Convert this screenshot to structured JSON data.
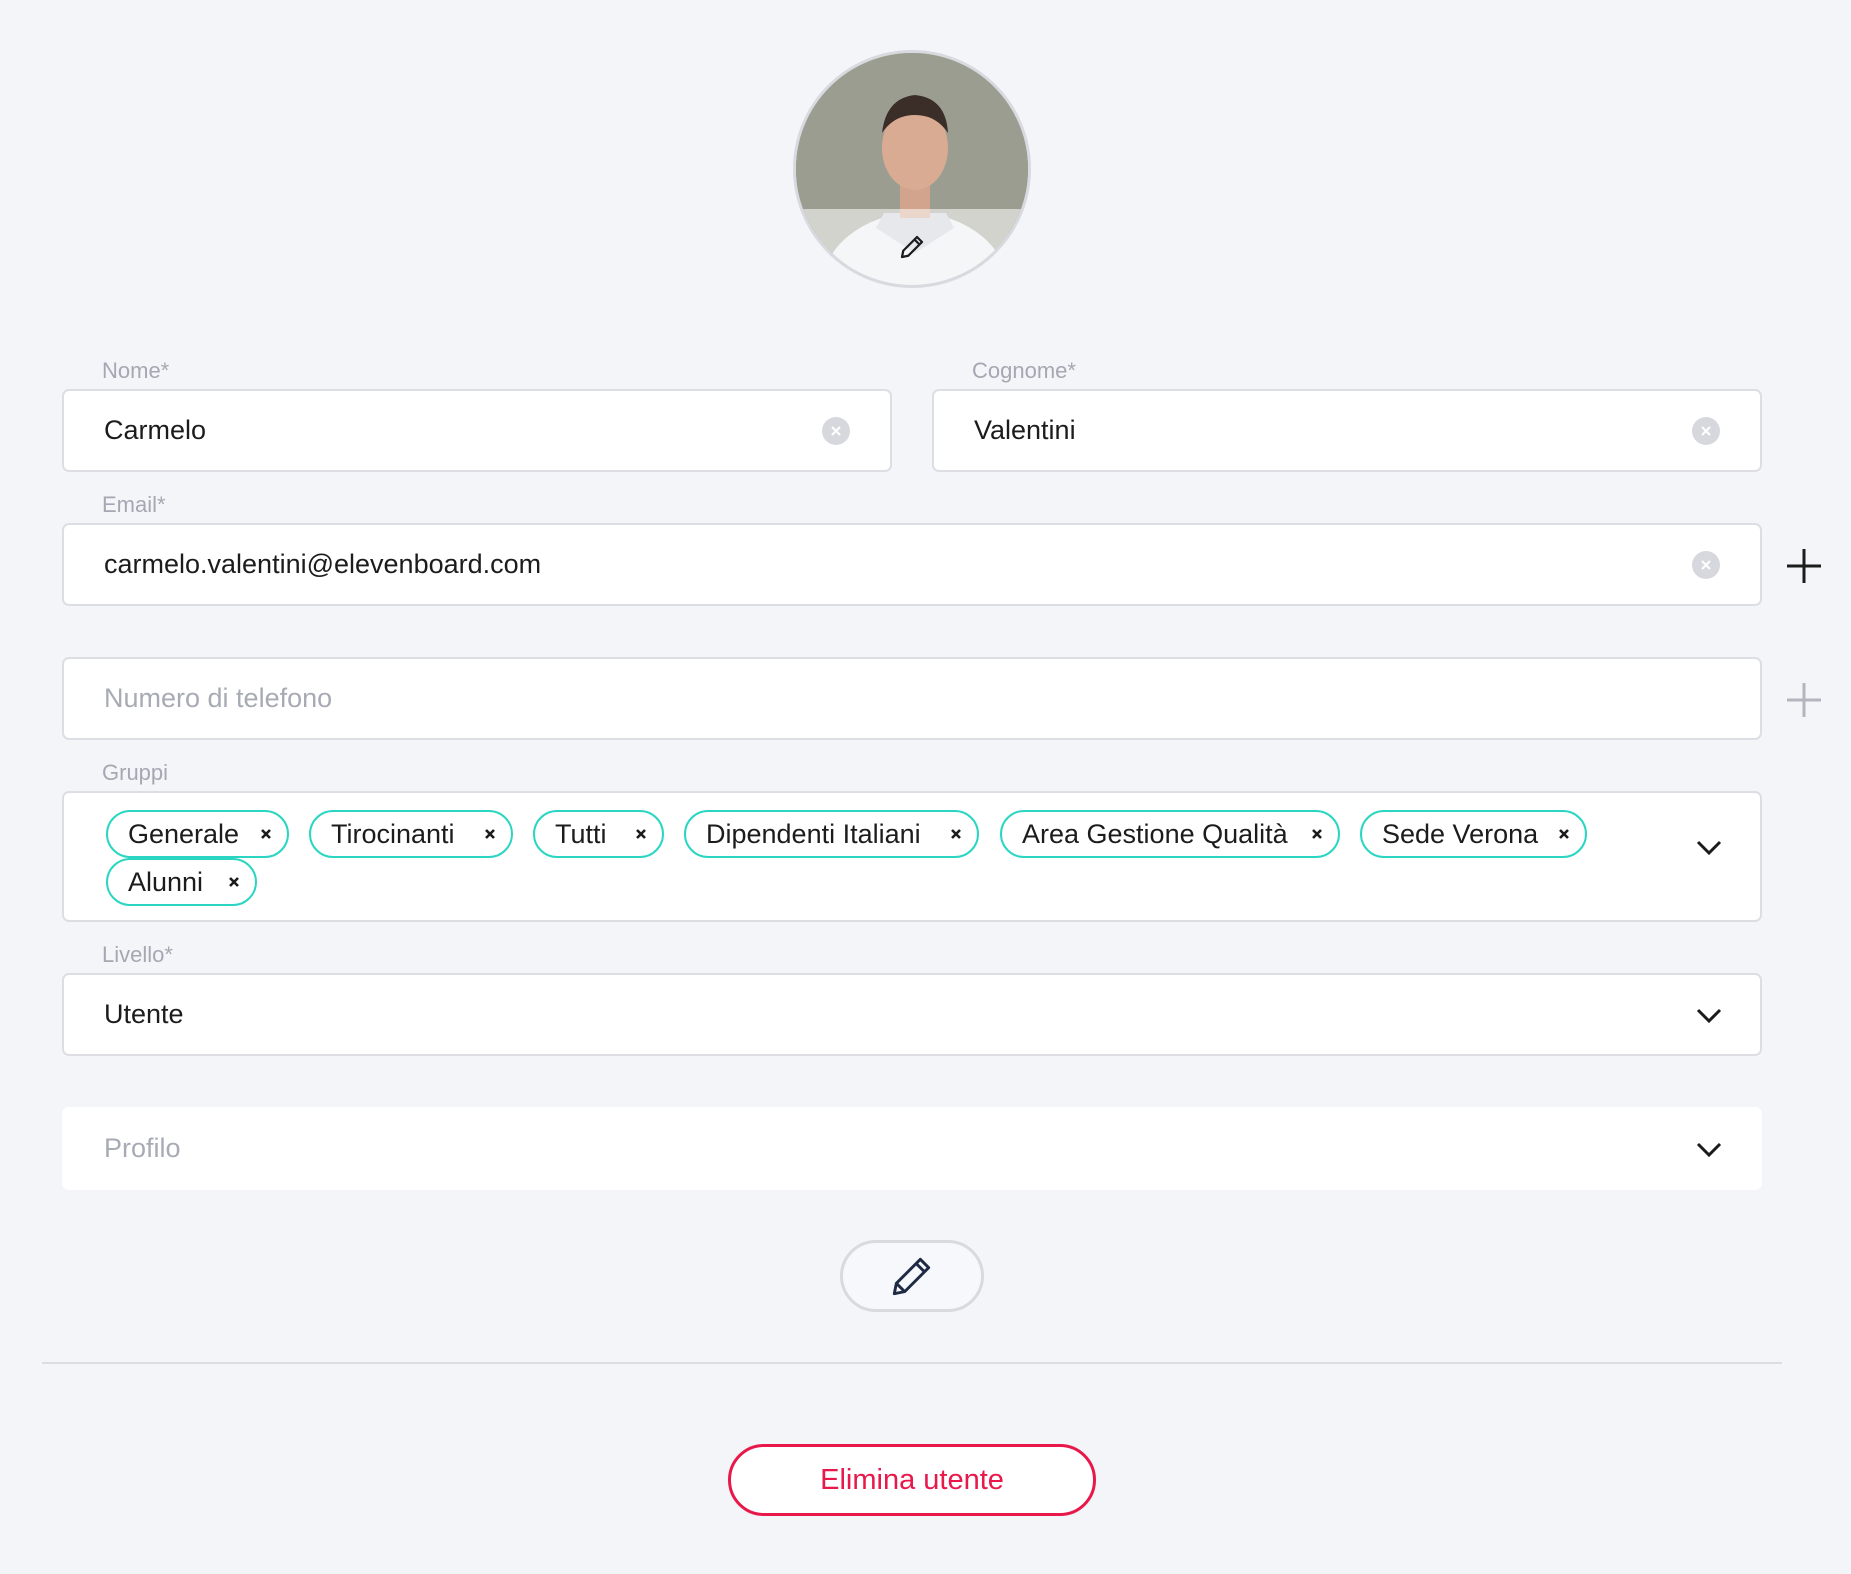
{
  "avatar": {
    "edit_icon": "pencil-icon"
  },
  "form": {
    "nome": {
      "label": "Nome*",
      "value": "Carmelo"
    },
    "cognome": {
      "label": "Cognome*",
      "value": "Valentini"
    },
    "email": {
      "label": "Email*",
      "value": "carmelo.valentini@elevenboard.com"
    },
    "telefono": {
      "placeholder": "Numero di telefono"
    },
    "gruppi": {
      "label": "Gruppi",
      "chips": [
        "Generale",
        "Tirocinanti",
        "Tutti",
        "Dipendenti Italiani",
        "Area Gestione Qualità",
        "Sede Verona",
        "Alunni"
      ]
    },
    "livello": {
      "label": "Livello*",
      "value": "Utente"
    },
    "profilo": {
      "placeholder": "Profilo"
    }
  },
  "actions": {
    "edit_icon": "pencil-icon",
    "delete_label": "Elimina utente"
  },
  "colors": {
    "chip_border": "#2ad6c2",
    "danger": "#e8184a",
    "background": "#f4f5f9"
  }
}
